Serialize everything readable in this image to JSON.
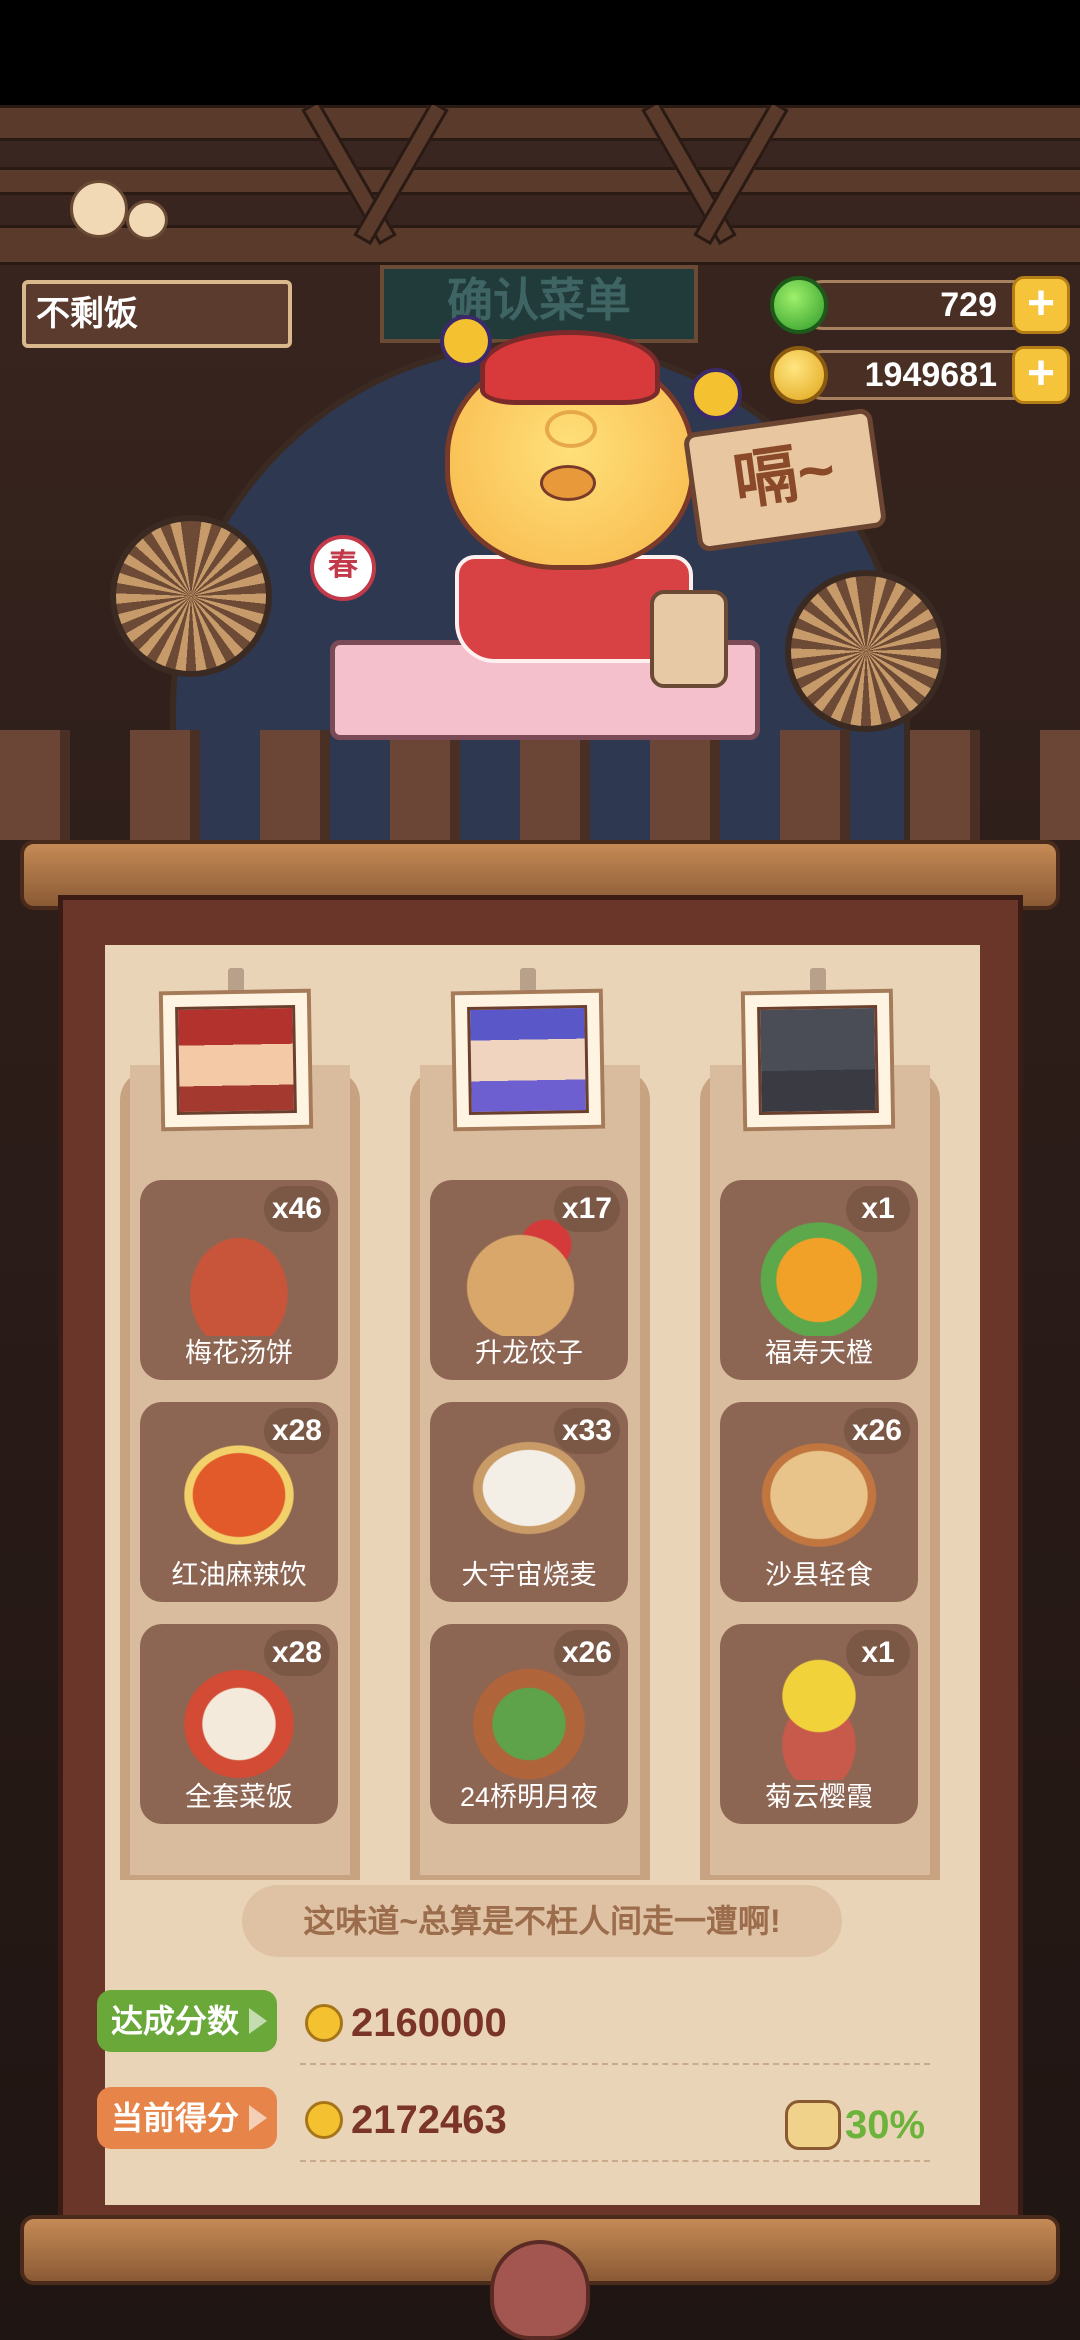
{
  "player": {
    "name": "不剩饭"
  },
  "resources": {
    "jade": "729",
    "gold": "1949681"
  },
  "shop_sign": "确认菜单",
  "speech": "嗝~",
  "character_badge": "春",
  "dishes": [
    {
      "name": "梅花汤饼",
      "count": "x46"
    },
    {
      "name": "升龙饺子",
      "count": "x17"
    },
    {
      "name": "福寿天橙",
      "count": "x1"
    },
    {
      "name": "红油麻辣饮",
      "count": "x28"
    },
    {
      "name": "大宇宙烧麦",
      "count": "x33"
    },
    {
      "name": "沙县轻食",
      "count": "x26"
    },
    {
      "name": "全套菜饭",
      "count": "x28"
    },
    {
      "name": "24桥明月夜",
      "count": "x26"
    },
    {
      "name": "菊云樱霞",
      "count": "x1"
    }
  ],
  "quote": "这味道~总算是不枉人间走一遭啊!",
  "target": {
    "label": "达成分数",
    "value": "2160000"
  },
  "current": {
    "label": "当前得分",
    "value": "2172463",
    "bonus": "30%"
  },
  "colors": {
    "accent_green": "#6bb33a",
    "tag_green": "#6aa83a",
    "tag_orange": "#e6844a",
    "score_brown": "#7a3528"
  }
}
